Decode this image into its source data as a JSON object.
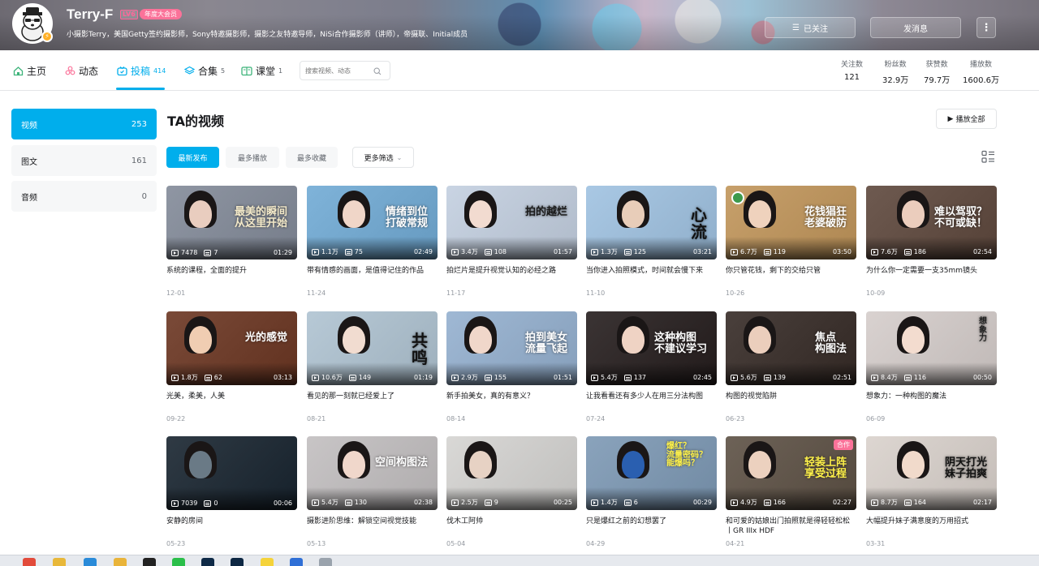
{
  "header": {
    "username": "Terry-F",
    "level": "LV6",
    "vip_badge": "年度大会员",
    "signature": "小摄影Terry，美国Getty签约摄影师，Sony特邀摄影师，摄影之友特邀导师，NiSi合作摄影师（讲师），帝摄联、Initial成员",
    "follow_button": "已关注",
    "message_button": "发消息",
    "more_button": "⋮"
  },
  "nav": {
    "tabs": [
      {
        "label": "主页",
        "icon": "home-icon",
        "count": ""
      },
      {
        "label": "动态",
        "icon": "dynamic-icon",
        "count": ""
      },
      {
        "label": "投稿",
        "icon": "upload-icon",
        "count": "414"
      },
      {
        "label": "合集",
        "icon": "collection-icon",
        "count": "5"
      },
      {
        "label": "课堂",
        "icon": "course-icon",
        "count": "1"
      }
    ],
    "search_placeholder": "搜索视频、动态",
    "stats": [
      {
        "label": "关注数",
        "value": "121"
      },
      {
        "label": "粉丝数",
        "value": "32.9万"
      },
      {
        "label": "获赞数",
        "value": "79.7万"
      },
      {
        "label": "播放数",
        "value": "1600.6万"
      }
    ]
  },
  "sidebar": {
    "items": [
      {
        "label": "视频",
        "count": "253"
      },
      {
        "label": "图文",
        "count": "161"
      },
      {
        "label": "音频",
        "count": "0"
      }
    ]
  },
  "content": {
    "title": "TA的视频",
    "play_all": "播放全部",
    "filters": [
      "最新发布",
      "最多播放",
      "最多收藏"
    ],
    "more_filter": "更多筛选",
    "videos": [
      {
        "title": "系统的课程，全面的提升",
        "date": "12-01",
        "views": "7478",
        "danmaku": "7",
        "duration": "01:29",
        "cover_text": "最美的瞬间\n从这里开始",
        "bg": "#8f96a3",
        "face": "#e9cdbf",
        "txt_color": "#f3e9c9"
      },
      {
        "title": "带有情感的画面，是值得记住的作品",
        "date": "11-24",
        "views": "1.1万",
        "danmaku": "75",
        "duration": "02:49",
        "cover_text": "情绪到位\n打破常规",
        "bg": "#7fb3d9",
        "face": "#f0d6c8",
        "txt_color": "#ffffff"
      },
      {
        "title": "拍烂片是提升视觉认知的必经之路",
        "date": "11-17",
        "views": "3.4万",
        "danmaku": "108",
        "duration": "01:57",
        "cover_text": "拍的越烂",
        "bg": "#c9d4e3",
        "face": "#f2dbd0",
        "txt_color": "#1a1a1a"
      },
      {
        "title": "当你进入拍照模式，时间就会慢下来",
        "date": "11-10",
        "views": "1.3万",
        "danmaku": "125",
        "duration": "03:21",
        "cover_text": "心\n流",
        "bg": "#a9c8e4",
        "face": "#e8cdb9",
        "txt_color": "#111111"
      },
      {
        "title": "你只管花钱，剩下的交给只管",
        "date": "10-26",
        "views": "6.7万",
        "danmaku": "119",
        "duration": "03:50",
        "cover_text": "花钱猖狂\n老婆破防",
        "bg": "#c7a06b",
        "face": "#efd2bd",
        "txt_color": "#ffffff"
      },
      {
        "title": "为什么你一定需要一支35mm镜头",
        "date": "10-09",
        "views": "7.6万",
        "danmaku": "186",
        "duration": "02:54",
        "cover_text": "难以驾驭？\n不可或缺！",
        "bg": "#6e5a50",
        "face": "#ebcdbd",
        "txt_color": "#ffffff"
      },
      {
        "title": "光美，柔美，人美",
        "date": "09-22",
        "views": "1.8万",
        "danmaku": "62",
        "duration": "03:13",
        "cover_text": "光的感觉",
        "bg": "#7a4a38",
        "face": "#f0cdb2",
        "txt_color": "#ffffff"
      },
      {
        "title": "看见的那一刻就已经爱上了",
        "date": "08-21",
        "views": "10.6万",
        "danmaku": "149",
        "duration": "01:19",
        "cover_text": "共\n鸣",
        "bg": "#b7c9d6",
        "face": "#f1dcd0",
        "txt_color": "#111111"
      },
      {
        "title": "新手拍美女，真的有意义？",
        "date": "08-14",
        "views": "2.9万",
        "danmaku": "155",
        "duration": "01:51",
        "cover_text": "拍到美女\n流量飞起",
        "bg": "#9fb8d4",
        "face": "#f0d7ca",
        "txt_color": "#ffffff"
      },
      {
        "title": "让我看看还有多少人在用三分法构图",
        "date": "07-24",
        "views": "5.4万",
        "danmaku": "137",
        "duration": "02:45",
        "cover_text": "这种构图\n不建议学习",
        "bg": "#3b3434",
        "face": "#efd3c4",
        "txt_color": "#ffffff"
      },
      {
        "title": "构图的视觉陷阱",
        "date": "06-23",
        "views": "5.6万",
        "danmaku": "139",
        "duration": "02:51",
        "cover_text": "焦点\n构图法",
        "bg": "#4a403c",
        "face": "#ebcebc",
        "txt_color": "#ffffff"
      },
      {
        "title": "想象力：一种构图的魔法",
        "date": "06-09",
        "views": "8.4万",
        "danmaku": "116",
        "duration": "00:50",
        "cover_text": "想\n象\n力",
        "bg": "#d9d2d0",
        "face": "#f3dccf",
        "txt_color": "#222222"
      },
      {
        "title": "安静的房间",
        "date": "05-23",
        "views": "7039",
        "danmaku": "0",
        "duration": "00:06",
        "cover_text": "",
        "bg": "#2f3a44",
        "face": "#6a7a86",
        "txt_color": "#ffffff"
      },
      {
        "title": "摄影进阶思维：解锁空间视觉技能",
        "date": "05-13",
        "views": "5.4万",
        "danmaku": "130",
        "duration": "02:38",
        "cover_text": "空间构图法",
        "bg": "#c8c5c6",
        "face": "#f0d7cb",
        "txt_color": "#ffffff"
      },
      {
        "title": "伐木工阿帅",
        "date": "05-04",
        "views": "2.5万",
        "danmaku": "9",
        "duration": "00:25",
        "cover_text": "",
        "bg": "#d9d8d6",
        "face": "#e7d2c4",
        "txt_color": "#ffffff"
      },
      {
        "title": "只是爆红之前的幻想罢了",
        "date": "04-29",
        "views": "1.4万",
        "danmaku": "6",
        "duration": "00:29",
        "cover_text": "爆红？\n流量密码？\n能爆吗？",
        "bg": "#8aa3bc",
        "face": "#2a5fb0",
        "txt_color": "#fff24a"
      },
      {
        "title": "和可爱的姑娘出门拍照就是得轻轻松松丨GR IIIx HDF",
        "date": "04-21",
        "views": "4.9万",
        "danmaku": "166",
        "duration": "02:27",
        "cover_text": "轻装上阵\n享受过程",
        "bg": "#6d6257",
        "face": "#ecd1bf",
        "txt_color": "#fff24a",
        "badge": "合作"
      },
      {
        "title": "大幅提升妹子满意度的万用招式",
        "date": "03-31",
        "views": "8.7万",
        "danmaku": "164",
        "duration": "02:17",
        "cover_text": "阴天打光\n妹子拍爽",
        "bg": "#ddd6d1",
        "face": "#f1dacb",
        "txt_color": "#111111"
      }
    ]
  },
  "colors": {
    "accent": "#00aeec",
    "pink": "#fb7299",
    "text_secondary": "#61666d",
    "text_muted": "#9499a0"
  }
}
